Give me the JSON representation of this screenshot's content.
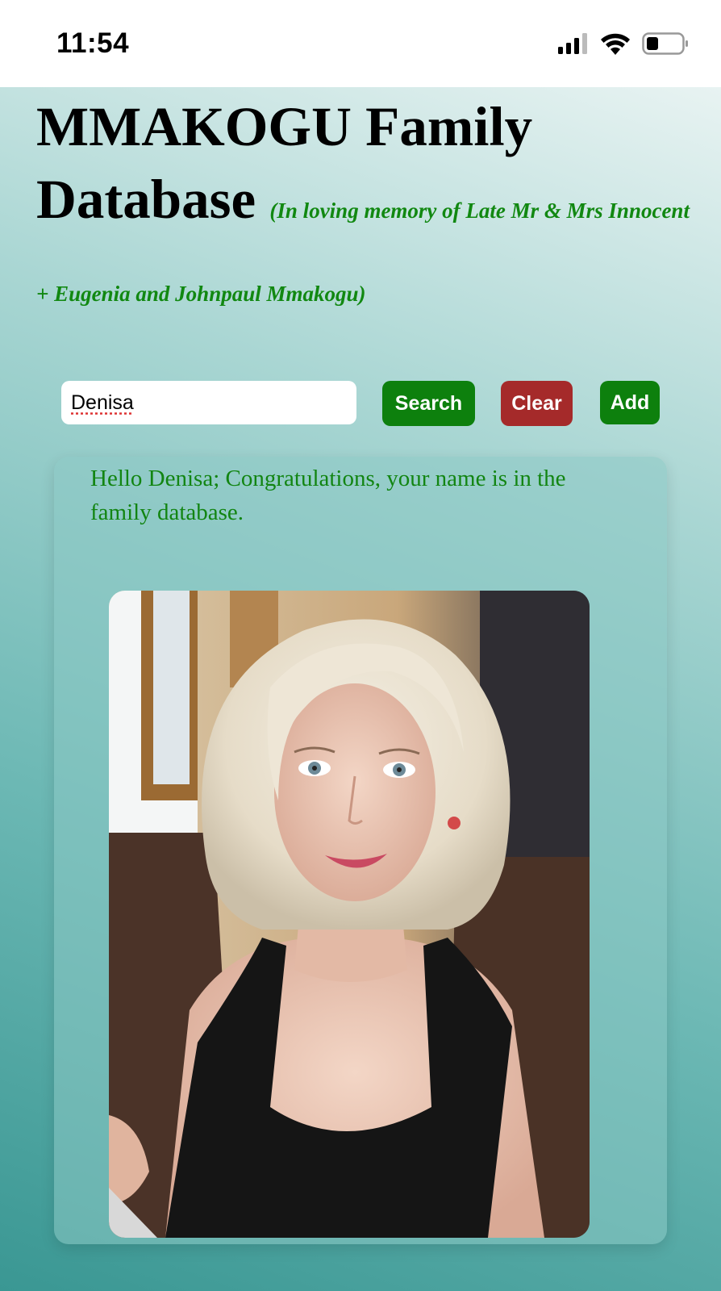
{
  "status_bar": {
    "time": "11:54",
    "icons": [
      "cellular-signal-icon",
      "wifi-icon",
      "battery-icon"
    ]
  },
  "header": {
    "title": "MMAKOGU Family Database",
    "subtitle": "(In loving memory of Late Mr & Mrs Innocent + Eugenia and Johnpaul Mmakogu)"
  },
  "search": {
    "value": "Denisa",
    "search_label": "Search",
    "clear_label": "Clear",
    "add_label": "Add"
  },
  "result": {
    "message": "Hello Denisa; Congratulations, your name is in the family database.",
    "photo": "portrait-photo"
  },
  "colors": {
    "accent_green": "#0d800d",
    "clear_red": "#a52a2a",
    "subtitle_green": "#118811",
    "background_teal": "#3a9793"
  }
}
